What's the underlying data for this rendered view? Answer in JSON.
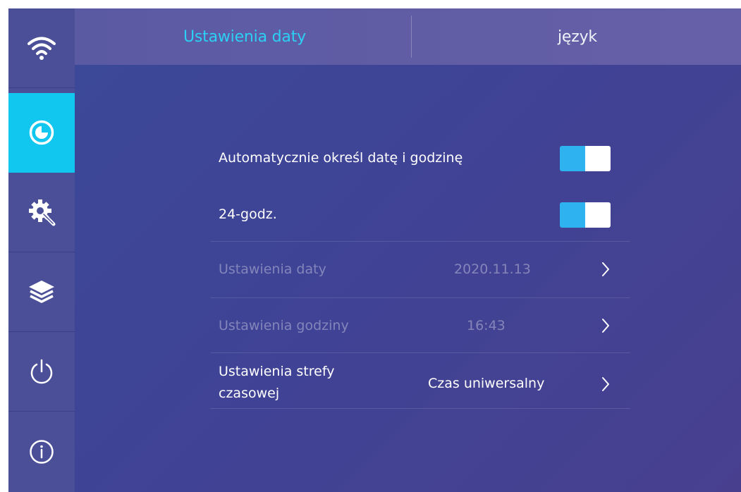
{
  "colors": {
    "accent": "#12c7ef",
    "tab_active": "#2cd0f5",
    "toggle_on": "#2eb2f0",
    "sidebar_bg": "#4b4f98",
    "content_bg": "#3f4396"
  },
  "sidebar": {
    "items": [
      {
        "icon": "wifi-icon",
        "active": false
      },
      {
        "icon": "clock-icon",
        "active": true
      },
      {
        "icon": "settings-gear-icon",
        "active": false
      },
      {
        "icon": "layers-icon",
        "active": false
      },
      {
        "icon": "power-icon",
        "active": false
      },
      {
        "icon": "info-icon",
        "active": false
      }
    ]
  },
  "header": {
    "tabs": [
      {
        "label": "Ustawienia daty",
        "active": true
      },
      {
        "label": "język",
        "active": false
      }
    ]
  },
  "settings": {
    "auto_datetime": {
      "label": "Automatycznie określ datę i godzinę",
      "enabled": true
    },
    "format_24h": {
      "label": "24-godz.",
      "enabled": true
    },
    "date_setting": {
      "label": "Ustawienia daty",
      "value": "2020.11.13",
      "disabled": true
    },
    "time_setting": {
      "label": "Ustawienia godziny",
      "value": "16:43",
      "disabled": true
    },
    "timezone_setting": {
      "label_line1": "Ustawienia strefy",
      "label_line2": "czasowej",
      "value": "Czas uniwersalny",
      "disabled": false
    }
  }
}
